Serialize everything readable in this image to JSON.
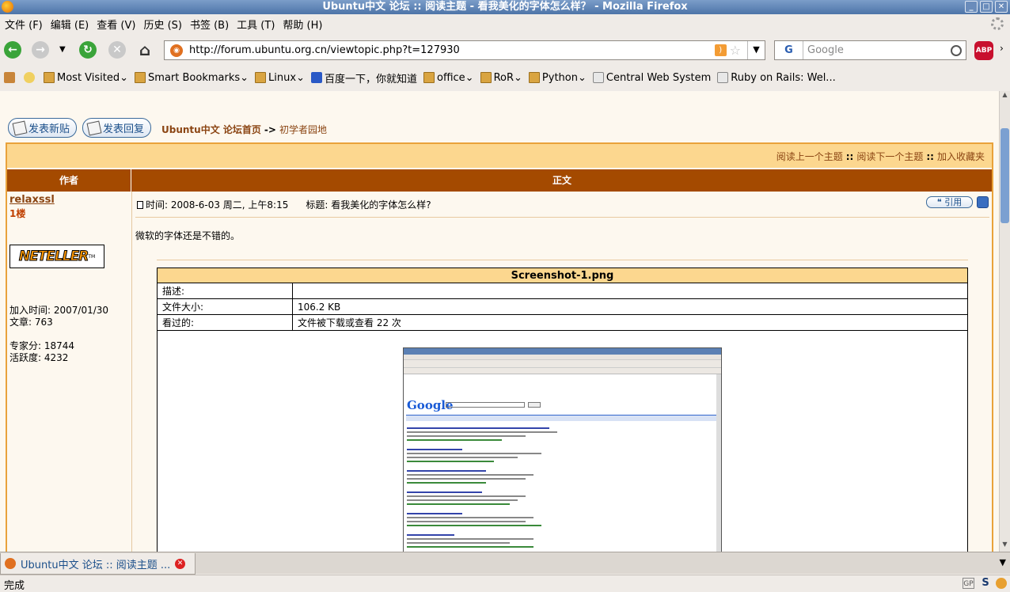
{
  "window": {
    "title": "Ubuntu中文 论坛 :: 阅读主题 - 看我美化的字体怎么样？ - Mozilla Firefox",
    "controls": [
      "minimize",
      "maximize",
      "close"
    ]
  },
  "menu": [
    "文件 (F)",
    "编辑 (E)",
    "查看 (V)",
    "历史 (S)",
    "书签 (B)",
    "工具 (T)",
    "帮助 (H)"
  ],
  "navigation": {
    "url": "http://forum.ubuntu.org.cn/viewtopic.php?t=127930",
    "search_placeholder": "Google",
    "search_engine_icon": "G",
    "adblock_label": "ABP"
  },
  "bookmarks": [
    {
      "label": "Most Visited",
      "icon": "folder-icon",
      "menu": true
    },
    {
      "label": "Smart Bookmarks",
      "icon": "folder-icon",
      "menu": true
    },
    {
      "label": "Linux",
      "icon": "folder-icon",
      "menu": true
    },
    {
      "label": "百度一下，你就知道",
      "icon": "baidu-icon",
      "menu": false
    },
    {
      "label": "office",
      "icon": "folder-icon",
      "menu": true
    },
    {
      "label": "RoR",
      "icon": "folder-icon",
      "menu": true
    },
    {
      "label": "Python",
      "icon": "folder-icon",
      "menu": true
    },
    {
      "label": "Central Web System",
      "icon": "page-icon",
      "menu": false
    },
    {
      "label": "Ruby on Rails: Wel...",
      "icon": "page-icon",
      "menu": false
    }
  ],
  "page": {
    "new_topic_button": "发表新贴",
    "reply_button": "发表回复",
    "breadcrumb": {
      "home": "Ubuntu中文 论坛首页",
      "separator": "->",
      "current": "初学者园地"
    },
    "topic_nav": {
      "prev": "阅读上一个主题",
      "next": "阅读下一个主题",
      "bookmark": "加入收藏夹",
      "separator": "::"
    },
    "table_headers": {
      "author": "作者",
      "body": "正文"
    },
    "post": {
      "username": "relaxssl",
      "floor": "1楼",
      "badge_text": "NETELLER",
      "join_date": "加入时间: 2007/01/30",
      "posts": "文章: 763",
      "expert_points": "专家分: 18744",
      "activity": "活跃度: 4232",
      "time": "时间: 2008-6-03 周二, 上午8:15",
      "subject": "标题: 看我美化的字体怎么样?",
      "quote_button": "引用",
      "body": "微软的字体还是不错的。"
    },
    "attachment": {
      "filename": "Screenshot-1.png",
      "rows": [
        {
          "key": "描述:",
          "value": ""
        },
        {
          "key": "文件大小:",
          "value": "106.2 KB"
        },
        {
          "key": "看过的:",
          "value": "文件被下载或查看 22 次"
        }
      ],
      "thumbnail_logo": "Google"
    }
  },
  "tabs": [
    {
      "label": "Ubuntu中文 论坛 :: 阅读主题 ...",
      "active": true
    }
  ],
  "status": {
    "text": "完成",
    "indicators": [
      "GP",
      "S"
    ]
  }
}
